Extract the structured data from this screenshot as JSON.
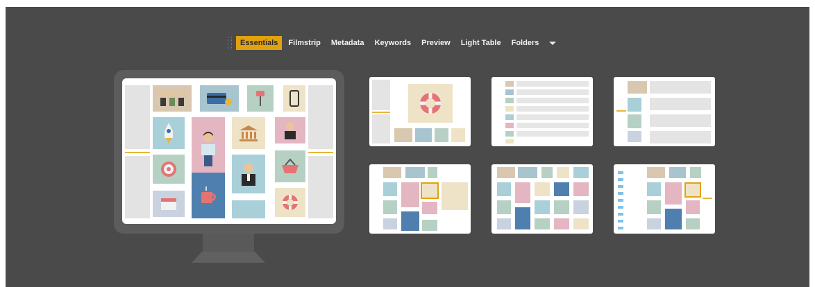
{
  "workspace_bar": {
    "tabs": [
      {
        "label": "Essentials",
        "active": true
      },
      {
        "label": "Filmstrip",
        "active": false
      },
      {
        "label": "Metadata",
        "active": false
      },
      {
        "label": "Keywords",
        "active": false
      },
      {
        "label": "Preview",
        "active": false
      },
      {
        "label": "Light Table",
        "active": false
      },
      {
        "label": "Folders",
        "active": false
      }
    ],
    "more_icon": "chevron-down-icon"
  },
  "colors": {
    "background": "#4a4a4a",
    "accent": "#e2a20f",
    "monitor": "#5c5c5c",
    "panel": "#e3e3e3"
  },
  "large_preview": {
    "layout": "Essentials",
    "content_icons": [
      "people-icon",
      "credit-card-icon",
      "push-pin-icon",
      "phone-icon",
      "rocket-icon",
      "reading-man-icon",
      "bank-icon",
      "businessman-icon",
      "target-icon",
      "businessman-2-icon",
      "basket-icon",
      "calendar-icon",
      "coffee-mug-icon",
      "lifebuoy-icon"
    ]
  },
  "layout_thumbnails": [
    {
      "layout": "Filmstrip"
    },
    {
      "layout": "Metadata"
    },
    {
      "layout": "Keywords"
    },
    {
      "layout": "Preview"
    },
    {
      "layout": "Light Table"
    },
    {
      "layout": "Folders"
    }
  ]
}
